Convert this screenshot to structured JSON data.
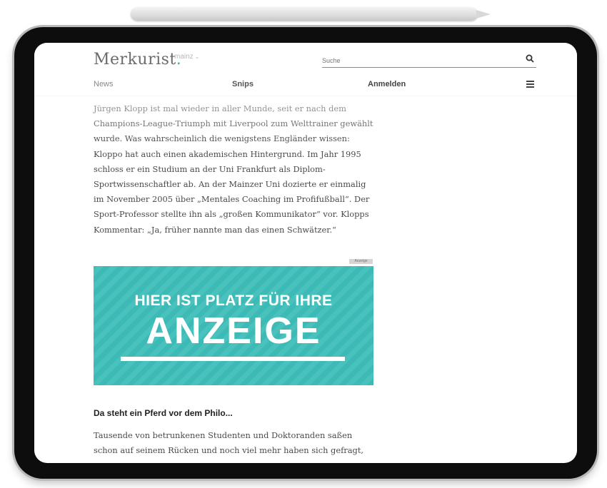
{
  "header": {
    "logo": "Merkurist",
    "logo_dot": ".",
    "city": "mainz",
    "search_placeholder": "Suche",
    "nav": {
      "news": "News",
      "snips": "Snips",
      "login": "Anmelden"
    }
  },
  "article": {
    "paragraph1": "Jürgen Klopp ist mal wieder in aller Munde, seit er nach dem Champions-League-Triumph mit Liverpool zum Welttrainer gewählt wurde. Was wahrscheinlich die wenigstens Engländer wissen: Kloppo hat auch einen akademischen Hintergrund. Im Jahr 1995 schloss er ein Studium an der Uni Frankfurt als Diplom-Sportwissenschaftler ab. An der Mainzer Uni dozierte er einmalig im November 2005 über „Mentales Coaching im Profifußball“. Der Sport-Professor stellte ihn als „großen Kommunikator“ vor. Klopps Kommentar: „Ja, früher nannte man das einen Schwätzer.“",
    "ad_label": "Anzeige",
    "ad_line1": "HIER IST PLATZ FÜR IHRE",
    "ad_line2": "ANZEIGE",
    "section_title": "Da steht ein Pferd vor dem Philo...",
    "paragraph2": "Tausende von betrunkenen Studenten und Doktoranden saßen schon auf seinem Rücken und noch viel mehr haben sich gefragt,"
  },
  "colors": {
    "accent": "#39b3b0",
    "ad_background": "#3dbab5"
  }
}
